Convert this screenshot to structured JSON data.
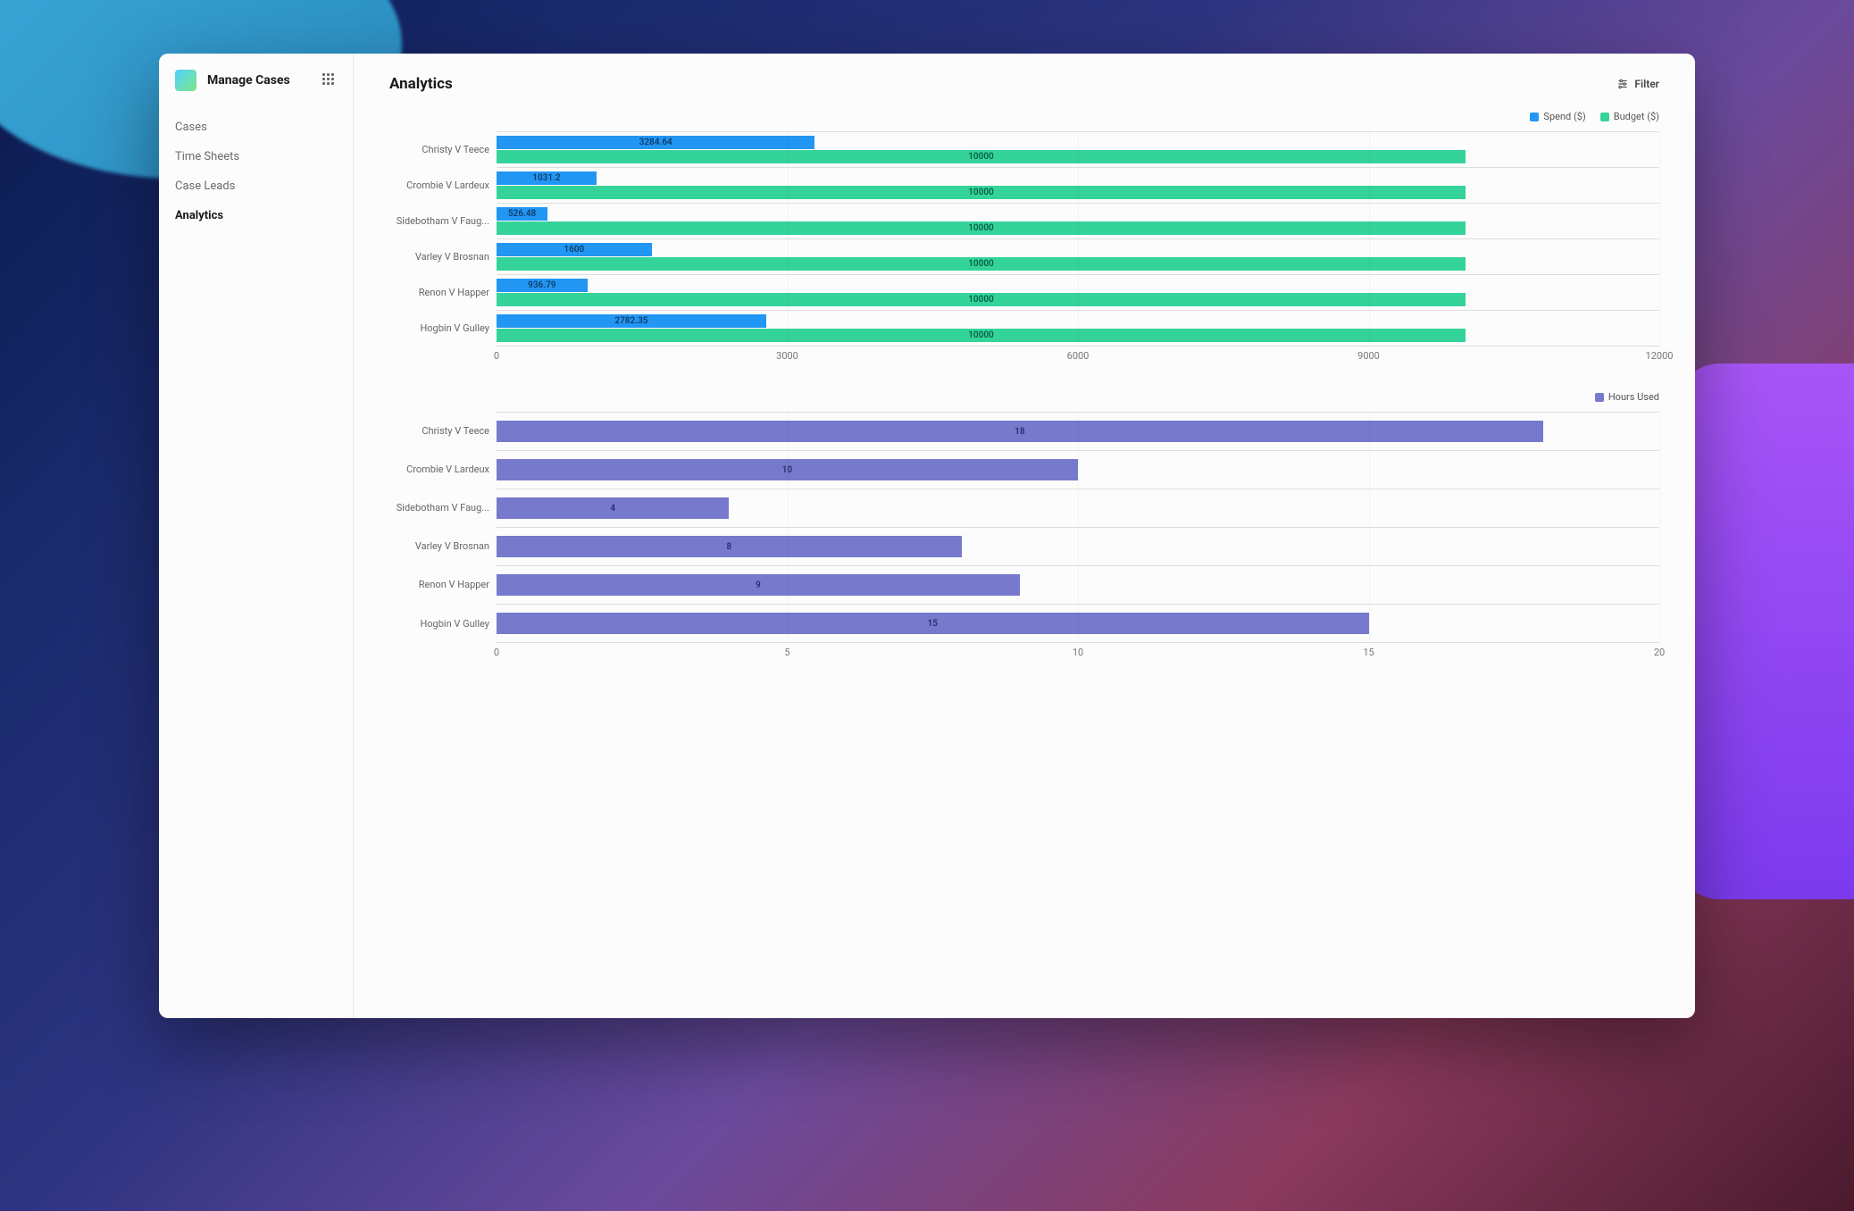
{
  "app": {
    "title": "Manage Cases"
  },
  "nav": {
    "items": [
      {
        "label": "Cases",
        "active": false
      },
      {
        "label": "Time Sheets",
        "active": false
      },
      {
        "label": "Case Leads",
        "active": false
      },
      {
        "label": "Analytics",
        "active": true
      }
    ]
  },
  "page": {
    "title": "Analytics",
    "filter_label": "Filter"
  },
  "colors": {
    "spend": "#2296f3",
    "budget": "#34d399",
    "hours": "#7679cc"
  },
  "legend1": [
    {
      "label": "Spend ($)",
      "colorKey": "spend"
    },
    {
      "label": "Budget ($)",
      "colorKey": "budget"
    }
  ],
  "legend2": [
    {
      "label": "Hours Used",
      "colorKey": "hours"
    }
  ],
  "chart_data": [
    {
      "type": "bar",
      "orientation": "horizontal",
      "categories": [
        "Christy V Teece",
        "Crombie V Lardeux",
        "Sidebotham V Faug...",
        "Varley V Brosnan",
        "Renon V Happer",
        "Hogbin V Gulley"
      ],
      "series": [
        {
          "name": "Spend ($)",
          "colorKey": "spend",
          "values": [
            3284.64,
            1031.2,
            526.48,
            1600,
            936.79,
            2782.35
          ]
        },
        {
          "name": "Budget ($)",
          "colorKey": "budget",
          "values": [
            10000,
            10000,
            10000,
            10000,
            10000,
            10000
          ]
        }
      ],
      "xlim": [
        0,
        12000
      ],
      "xticks": [
        0,
        3000,
        6000,
        9000,
        12000
      ]
    },
    {
      "type": "bar",
      "orientation": "horizontal",
      "categories": [
        "Christy V Teece",
        "Crombie V Lardeux",
        "Sidebotham V Faug...",
        "Varley V Brosnan",
        "Renon V Happer",
        "Hogbin V Gulley"
      ],
      "series": [
        {
          "name": "Hours Used",
          "colorKey": "hours",
          "values": [
            18,
            10,
            4,
            8,
            9,
            15
          ]
        }
      ],
      "xlim": [
        0,
        20
      ],
      "xticks": [
        0,
        5,
        10,
        15,
        20
      ]
    }
  ]
}
